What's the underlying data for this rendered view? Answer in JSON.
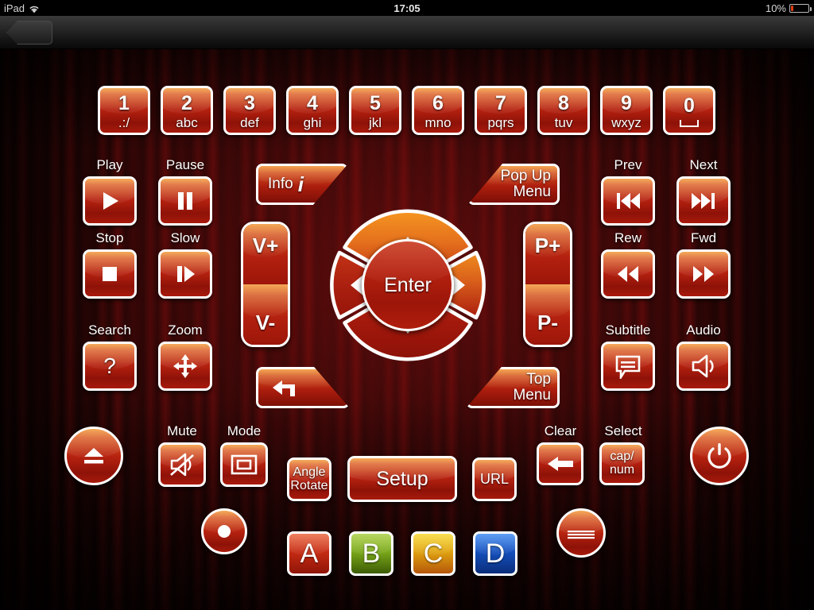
{
  "status_bar": {
    "carrier": "iPad",
    "wifi_icon": "wifi-icon",
    "time": "17:05",
    "battery_percent": "10%",
    "battery_icon": "battery-icon"
  },
  "nav_bar": {
    "back_button_label": ""
  },
  "numpad": [
    {
      "number": "1",
      "letters": ".:/"
    },
    {
      "number": "2",
      "letters": "abc"
    },
    {
      "number": "3",
      "letters": "def"
    },
    {
      "number": "4",
      "letters": "ghi"
    },
    {
      "number": "5",
      "letters": "jkl"
    },
    {
      "number": "6",
      "letters": "mno"
    },
    {
      "number": "7",
      "letters": "pqrs"
    },
    {
      "number": "8",
      "letters": "tuv"
    },
    {
      "number": "9",
      "letters": "wxyz"
    },
    {
      "number": "0",
      "letters": "space"
    }
  ],
  "transport_left": {
    "play": {
      "label": "Play",
      "icon": "play-icon"
    },
    "pause": {
      "label": "Pause",
      "icon": "pause-icon"
    },
    "stop": {
      "label": "Stop",
      "icon": "stop-icon"
    },
    "slow": {
      "label": "Slow",
      "icon": "slow-icon"
    },
    "search": {
      "label": "Search",
      "icon": "question-mark-icon"
    },
    "zoom": {
      "label": "Zoom",
      "icon": "four-way-arrows-icon"
    }
  },
  "transport_right": {
    "prev": {
      "label": "Prev",
      "icon": "skip-previous-icon"
    },
    "next": {
      "label": "Next",
      "icon": "skip-next-icon"
    },
    "rew": {
      "label": "Rew",
      "icon": "rewind-icon"
    },
    "fwd": {
      "label": "Fwd",
      "icon": "fast-forward-icon"
    },
    "subtitle": {
      "label": "Subtitle",
      "icon": "subtitle-bubble-icon"
    },
    "audio": {
      "label": "Audio",
      "icon": "speaker-icon"
    }
  },
  "center": {
    "info": "Info",
    "info_glyph": "i",
    "popup_menu_line1": "Pop Up",
    "popup_menu_line2": "Menu",
    "top_menu_line1": "Top",
    "top_menu_line2": "Menu",
    "return_icon": "return-arrow-icon",
    "enter": "Enter",
    "dpad_up_icon": "arrow-up-icon",
    "dpad_down_icon": "arrow-down-icon",
    "dpad_left_icon": "arrow-left-icon",
    "dpad_right_icon": "arrow-right-icon",
    "volume_up": "V+",
    "volume_down": "V-",
    "program_up": "P+",
    "program_down": "P-"
  },
  "bottom": {
    "eject": {
      "icon": "eject-icon"
    },
    "mute": {
      "label": "Mute",
      "icon": "mute-icon"
    },
    "mode": {
      "label": "Mode",
      "icon": "pip-mode-icon"
    },
    "record": {
      "icon": "record-icon"
    },
    "angle_rotate_line1": "Angle",
    "angle_rotate_line2": "Rotate",
    "setup": "Setup",
    "url": "URL",
    "clear": {
      "label": "Clear",
      "icon": "back-arrow-icon"
    },
    "select": {
      "label": "Select",
      "line1": "cap/",
      "line2": "num"
    },
    "logo": {
      "icon": "app-logo-icon"
    },
    "power": {
      "icon": "power-icon"
    }
  },
  "color_keys": [
    {
      "letter": "A",
      "color": "#c22b13",
      "top": "#e8552a",
      "bottom": "#8f1508"
    },
    {
      "letter": "B",
      "color": "#7aa81a",
      "top": "#9ec92b",
      "bottom": "#3d5c05"
    },
    {
      "letter": "C",
      "color": "#e0a310",
      "top": "#f7d318",
      "bottom": "#b5560a"
    },
    {
      "letter": "D",
      "color": "#1450bd",
      "top": "#2a7df0",
      "bottom": "#0b2d7a"
    }
  ],
  "theme": {
    "accent_orange": "#f0881a",
    "accent_red": "#b5210f",
    "background_dark": "#1d0404",
    "button_border": "#ffffff"
  }
}
